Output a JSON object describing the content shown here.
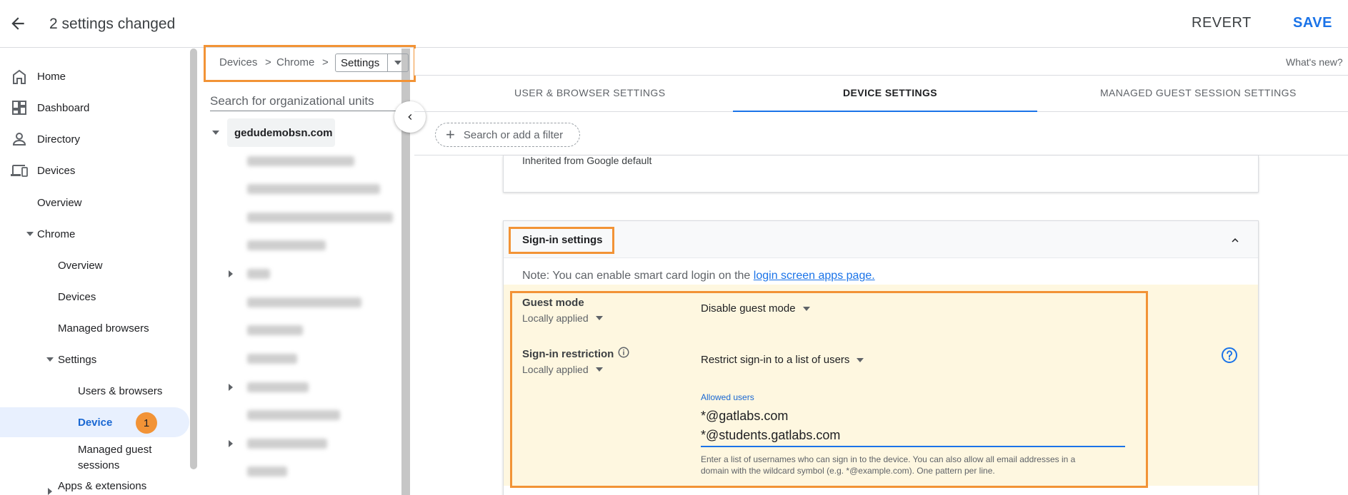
{
  "topbar": {
    "title": "2 settings changed",
    "revert_label": "REVERT",
    "save_label": "SAVE"
  },
  "nav": {
    "home": "Home",
    "dashboard": "Dashboard",
    "directory": "Directory",
    "devices": "Devices",
    "overview": "Overview",
    "chrome": "Chrome",
    "chrome_overview": "Overview",
    "chrome_devices": "Devices",
    "managed_browsers": "Managed browsers",
    "settings": "Settings",
    "users_browsers": "Users & browsers",
    "device": "Device",
    "device_badge": "1",
    "managed_guest_line1": "Managed guest",
    "managed_guest_line2": "sessions",
    "apps_extensions": "Apps & extensions"
  },
  "breadcrumb": {
    "devices": "Devices",
    "chrome": "Chrome",
    "settings": "Settings",
    "separator": ">"
  },
  "org": {
    "search_placeholder": "Search for organizational units",
    "root": "gedudemobsn.com"
  },
  "header_right": {
    "whats_new": "What's new?"
  },
  "tabs": {
    "user_browser": "USER & BROWSER SETTINGS",
    "device": "DEVICE SETTINGS",
    "managed_guest": "MANAGED GUEST SESSION SETTINGS"
  },
  "filter": {
    "placeholder": "Search or add a filter"
  },
  "card_top": {
    "inherited": "Inherited from Google default"
  },
  "signin": {
    "title": "Sign-in settings",
    "note_prefix": "Note: You can enable smart card login on the ",
    "note_link": "login screen apps page.",
    "guest_mode": {
      "label": "Guest mode",
      "applied": "Locally applied",
      "value": "Disable guest mode"
    },
    "signin_restriction": {
      "label": "Sign-in restriction",
      "applied": "Locally applied",
      "value": "Restrict sign-in to a list of users"
    },
    "allowed_users_label": "Allowed users",
    "allowed_users": [
      "*@gatlabs.com",
      "*@students.gatlabs.com"
    ],
    "helper_text": "Enter a list of usernames who can sign in to the device. You can also allow all email addresses in a domain with the wildcard symbol (e.g. *@example.com). One pattern per line."
  },
  "colors": {
    "accent": "#1a73e8",
    "highlight_orange": "#f29336",
    "policy_bg": "#fef7e0",
    "active_nav_bg": "#e8f0fe"
  }
}
